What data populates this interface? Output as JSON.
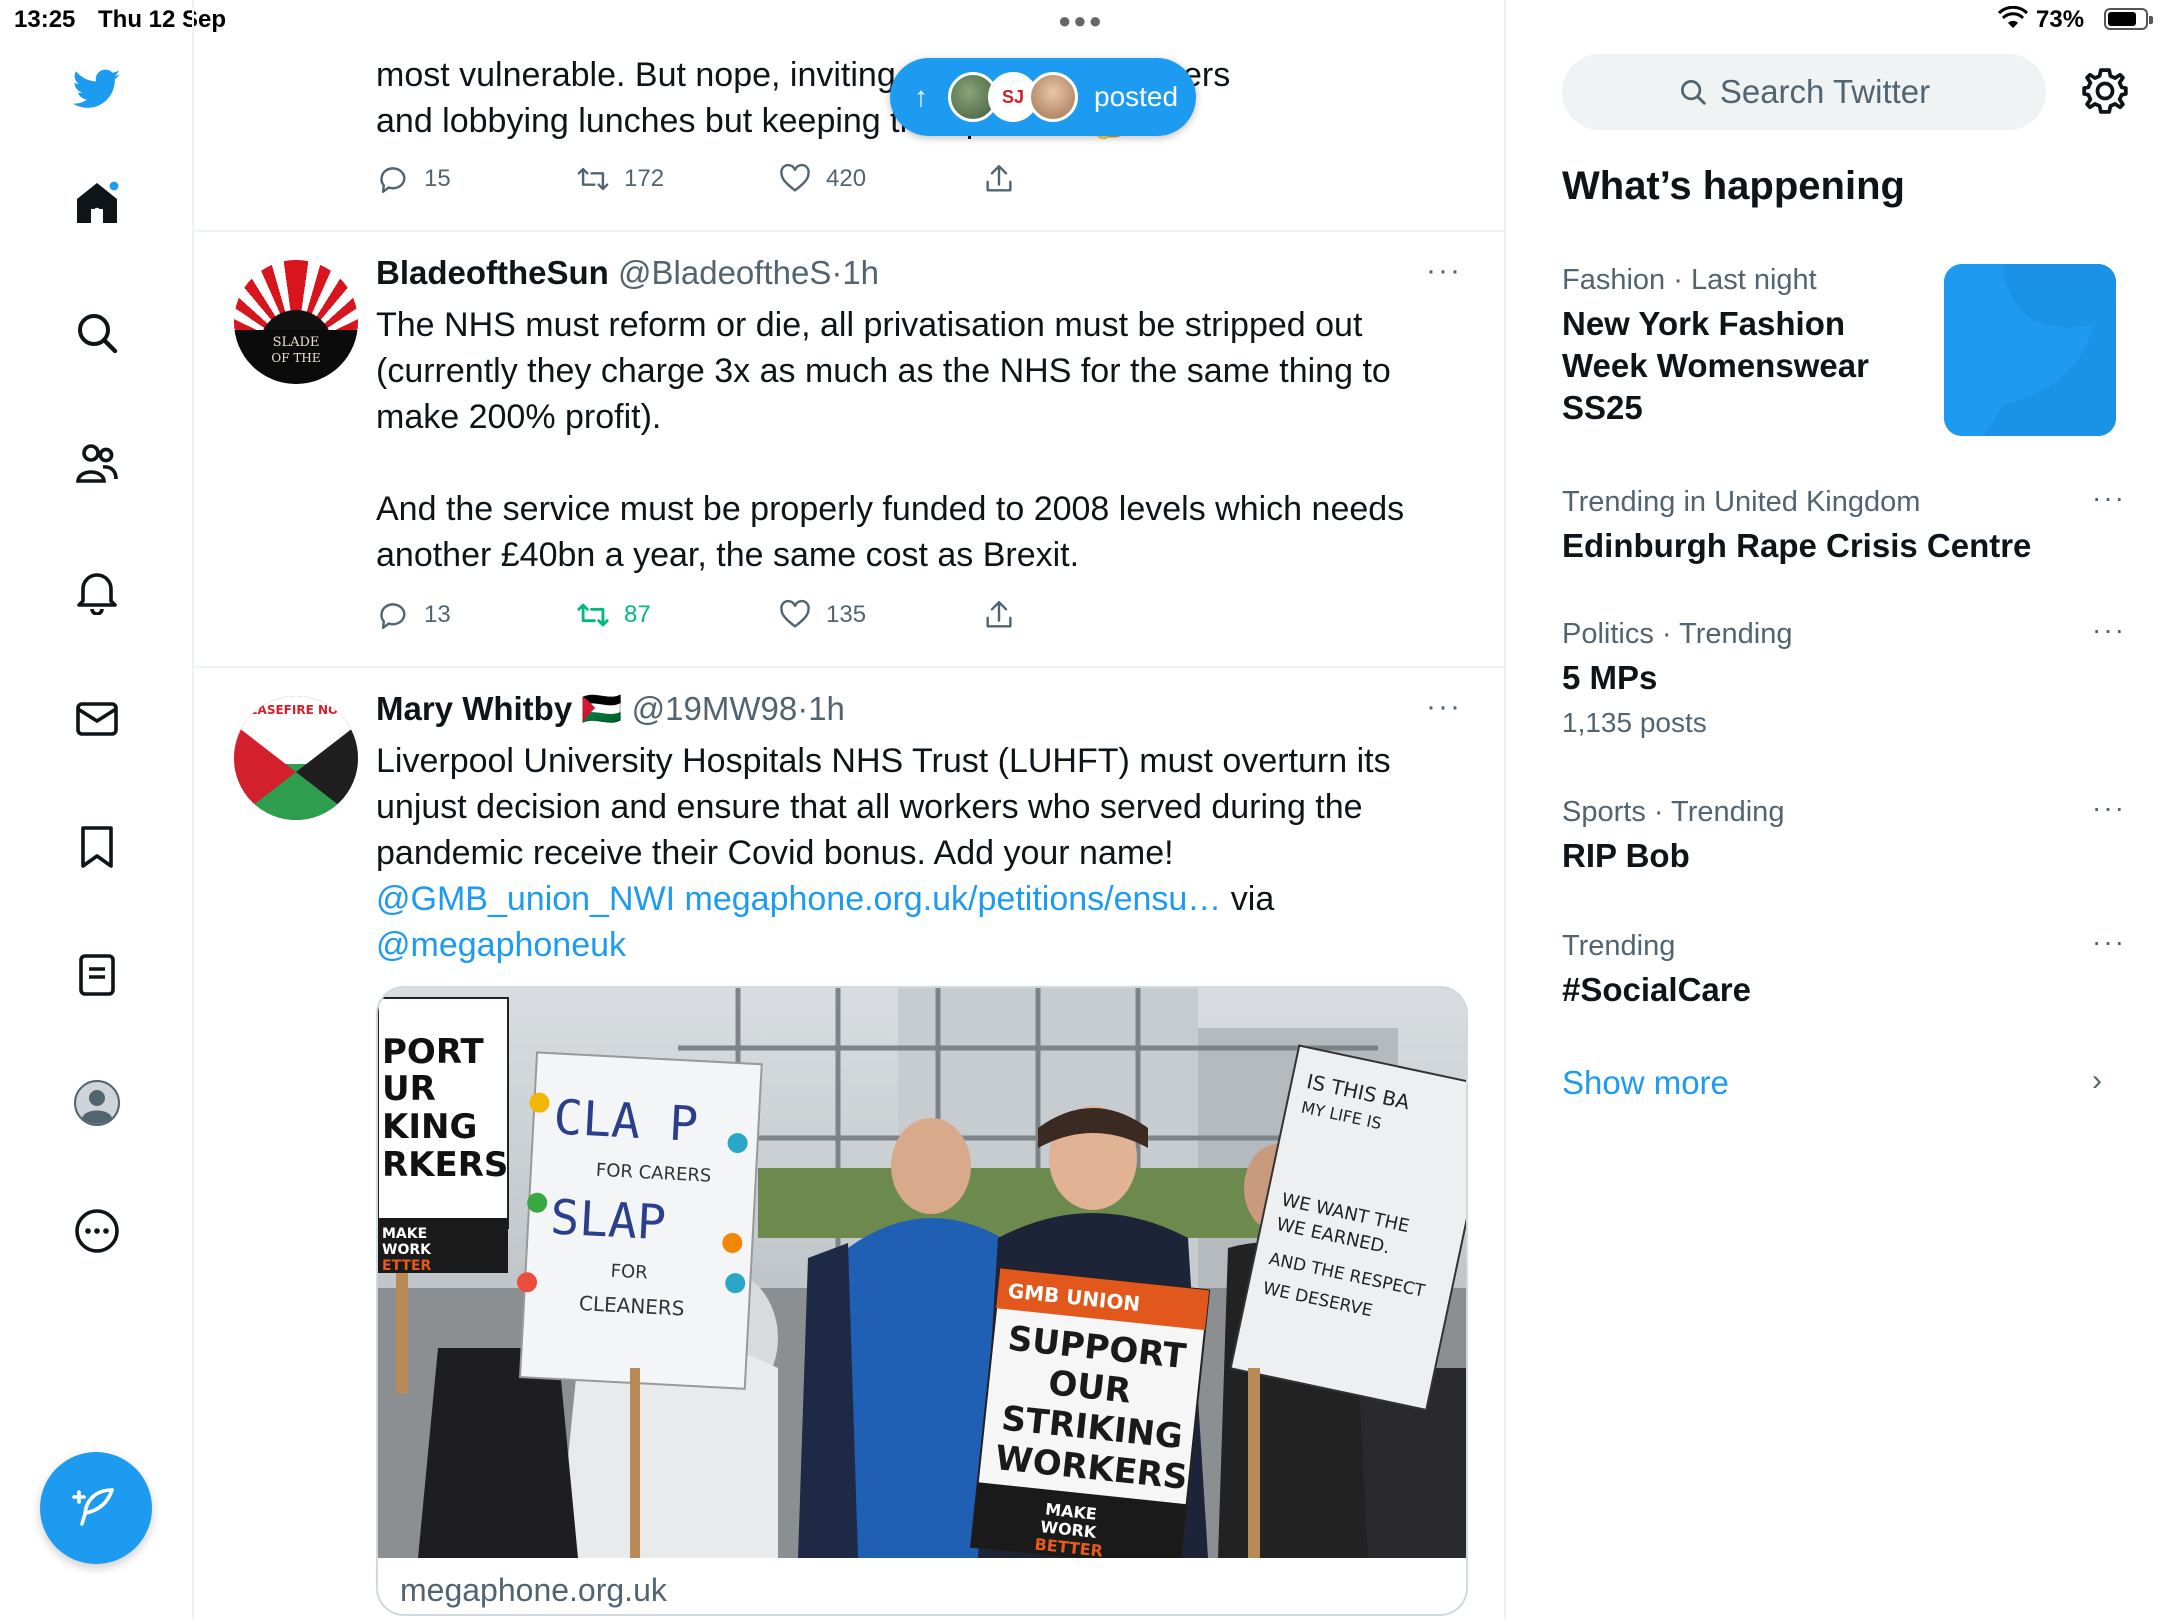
{
  "status_bar": {
    "time": "13:25",
    "date": "Thu 12 Sep",
    "battery": "73%",
    "battery_level": 0.73
  },
  "nav": {
    "icons": [
      "twitter-logo-icon",
      "home-icon",
      "search-icon",
      "communities-icon",
      "notifications-icon",
      "messages-icon",
      "bookmarks-icon",
      "lists-icon",
      "profile-icon",
      "more-icon"
    ],
    "brand_color": "#1d9bf0"
  },
  "new_posts_pill": {
    "label": "posted",
    "arrow": "↑",
    "badge": "SJ"
  },
  "timeline": {
    "partial_tweet": {
      "text": "most vulnerable. But nope, inviting them to fancy dinners\nand lobbying lunches but keeping their pockets 🤔",
      "replies": "15",
      "retweets": "172",
      "likes": "420"
    },
    "tweets": [
      {
        "name": "BladeoftheSun",
        "handle": "@BladeoftheS",
        "dot": "·",
        "ago": "1h",
        "more": "···",
        "text": "The NHS must reform or die, all privatisation must be stripped out (currently they charge 3x as much as the NHS for the same thing to make 200% profit).\n\nAnd the service must be properly funded to 2008 levels which needs another £40bn a year, the same cost as Brexit.",
        "replies": "13",
        "retweets": "87",
        "likes": "135",
        "avatar_text": "BLADE OF THE SUN"
      },
      {
        "name": "Mary Whitby",
        "flag": "🇵🇸",
        "handle": "@19MW98",
        "dot": "·",
        "ago": "1h",
        "more": "···",
        "text_before": "Liverpool University Hospitals NHS Trust (LUHFT) must overturn its unjust decision and ensure that all workers who served during the pandemic receive their Covid bonus. Add your name!\n",
        "mention1": "@GMB_union_NWI",
        "link": "megaphone.org.uk/petitions/ensu…",
        "via": " via",
        "mention2": "@megaphoneuk",
        "avatar_text": "CEASEFIRE NOW",
        "card_domain": "megaphone.org.uk",
        "photo_signs": {
          "sign1": "CLAP FOR CARERS SLAP FOR CLEANERS",
          "sign2": "SUPPORT OUR STRIKING WORKERS",
          "sign2_brand": "GMB UNION",
          "sign2_footer": "MAKE WORK BETTER",
          "sign3": "IS THIS BA MY LIFE IS",
          "sign3b": "WE WANT THE WE EARNED. AND THE RESPECT WE DESERVE",
          "sign_left": "PORT UR KING RKERS",
          "sign_left_footer": "MAKE WORK ETTER"
        }
      }
    ]
  },
  "sidebar": {
    "search_placeholder": "Search Twitter",
    "whats_happening": "What’s happening",
    "trends": [
      {
        "meta": "Fashion · Last night",
        "title": "New York Fashion Week Womenswear SS25",
        "posts": ""
      },
      {
        "meta": "Trending in United Kingdom",
        "title": "Edinburgh Rape Crisis Centre",
        "posts": ""
      },
      {
        "meta": "Politics · Trending",
        "title": "5 MPs",
        "posts": "1,135 posts"
      },
      {
        "meta": "Sports · Trending",
        "title": "RIP Bob",
        "posts": ""
      },
      {
        "meta": "Trending",
        "title": "#SocialCare",
        "posts": ""
      }
    ],
    "trend_more": "···",
    "show_more": "Show more",
    "chevron": "›"
  }
}
